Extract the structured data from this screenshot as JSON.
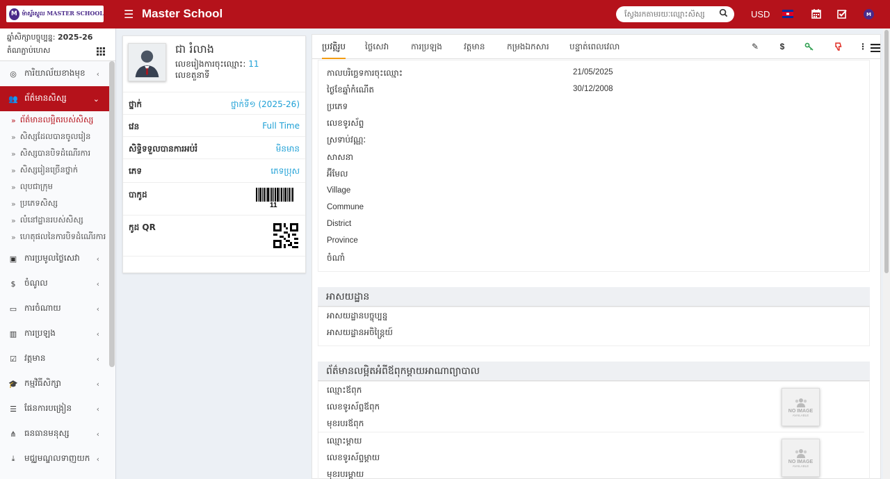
{
  "topbar": {
    "logo_text": "ម៉ាស្ទ័រស្គូល MASTER SCHOOL",
    "logo_letter": "M",
    "app_title": "Master School",
    "search_placeholder": "ស្វែងរកតាមរយៈឈ្មោះសិស្ស",
    "currency": "USD",
    "avatar_letter": "M"
  },
  "sidebar": {
    "year_label": "ឆ្នាំសិក្សាបច្ចុប្បន្ន:",
    "year_value": "2025-26",
    "branch": "តំណភ្ជាប់ហេស",
    "items": [
      {
        "label": "ការិយាល័យខាងមុខ",
        "icon": "dashboard-icon"
      },
      {
        "label": "ព័ត៌មានសិស្ស",
        "icon": "students-icon"
      },
      {
        "label": "ការប្រមូលថ្លៃសេវា",
        "icon": "money-icon"
      },
      {
        "label": "ចំណូល",
        "icon": "dollar-icon"
      },
      {
        "label": "ការចំណាយ",
        "icon": "card-icon"
      },
      {
        "label": "ការប្រឡង",
        "icon": "map-icon"
      },
      {
        "label": "វត្តមាន",
        "icon": "calendar-check-icon"
      },
      {
        "label": "កម្មវិធីសិក្សា",
        "icon": "graduation-cap-icon"
      },
      {
        "label": "ផែនការបង្រៀន",
        "icon": "list-icon"
      },
      {
        "label": "ធនធានមនុស្ស",
        "icon": "sitemap-icon"
      },
      {
        "label": "មជ្ឈមណ្ឌលទាញយក",
        "icon": "download-icon"
      }
    ],
    "subitems": [
      "ព័ត៌មានលម្អិតរបស់សិស្ស",
      "សិស្សដែលបានចូលរៀន",
      "សិស្សបានបិទដំណើរការ",
      "សិស្សរៀនច្រើនថ្នាក់",
      "លុបជាក្រុម",
      "ប្រភេទសិស្ស",
      "លំនៅដ្ឋានរបស់សិស្ស",
      "ហេតុផលនៃការបិទដំណើរការ"
    ]
  },
  "profile": {
    "name": "ជា រំលាង",
    "admission_label": "លេខរៀងការចុះឈ្មោះ:",
    "admission_no": "11",
    "roll_label": "លេខតួនាទី",
    "rows": [
      {
        "label": "ថ្នាក់",
        "value": "ថ្នាក់ទី១ (2025-26)"
      },
      {
        "label": "វេន",
        "value": "Full Time"
      },
      {
        "label": "សិទ្ធិទទួលបានការអប់រំ",
        "value": "មិនមាន"
      },
      {
        "label": "ភេទ",
        "value": "ភេទប្រុស"
      },
      {
        "label": "បាកូដ",
        "value": ""
      },
      {
        "label": "កូដ QR",
        "value": ""
      }
    ],
    "barcode_number": "11"
  },
  "tabs": [
    "ប្រវត្តិរូប",
    "ថ្លៃសេវា",
    "ការប្រឡង",
    "វត្តមាន",
    "កម្រងឯកសារ",
    "បន្ទាត់ពេលវេលា"
  ],
  "tab_icons": [
    "pencil-icon",
    "dollar-icon",
    "key-icon",
    "thumbs-down-icon",
    "more-vertical-icon"
  ],
  "details": [
    {
      "label": "កាលបរិច្ឆេទការចុះឈ្មោះ",
      "value": "21/05/2025"
    },
    {
      "label": "ថ្ងៃខែឆ្នាំកំណើត",
      "value": "30/12/2008"
    },
    {
      "label": "ប្រភេទ",
      "value": ""
    },
    {
      "label": "លេខទូរស័ព្ទ",
      "value": ""
    },
    {
      "label": "ស្រទាប់វណ្ណៈ",
      "value": ""
    },
    {
      "label": "សាសនា",
      "value": ""
    },
    {
      "label": "អ៊ីមែល",
      "value": ""
    },
    {
      "label": "Village",
      "value": ""
    },
    {
      "label": "Commune",
      "value": ""
    },
    {
      "label": "District",
      "value": ""
    },
    {
      "label": "Province",
      "value": ""
    },
    {
      "label": "ចំណាំ",
      "value": ""
    }
  ],
  "address": {
    "title": "អាសយដ្ឋាន",
    "current": "អាសយដ្ឋានបច្ចុប្បន្ន",
    "permanent": "អាសយដ្ឋានអចិន្ត្រៃយ៍"
  },
  "guardian": {
    "title": "ព័ត៌មានលម្អិតអំពីឪពុកម្តាយអាណាព្យាបាល",
    "father_name": "ឈ្មោះឪពុក",
    "father_phone": "លេខទូរស័ព្ទឪពុក",
    "father_job": "មុខរបរឪពុក",
    "mother_name": "ឈ្មោះម្តាយ",
    "mother_phone": "លេខទូរស័ព្ទម្តាយ",
    "mother_job": "មុខរបរម្តាយ",
    "noimg_t1": "NO IMAGE",
    "noimg_t2": "AVAILABLE"
  }
}
